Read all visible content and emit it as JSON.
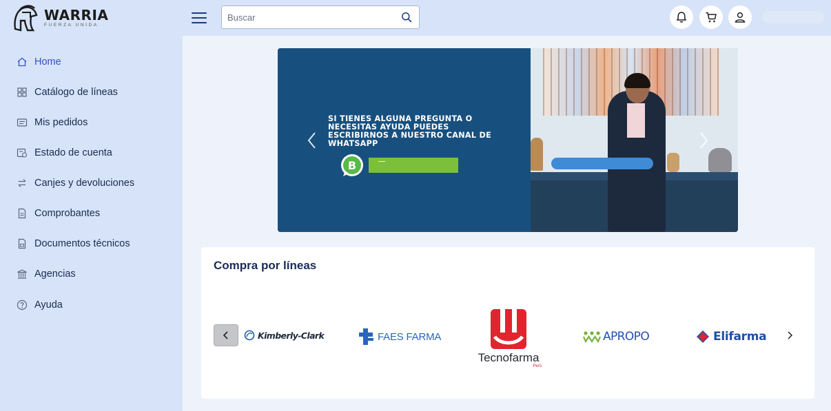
{
  "brand": {
    "name": "WARRIA",
    "tagline": "FUERZA UNIDA",
    "icon": "helmet-logo"
  },
  "header": {
    "menu_icon": "hamburger-menu-icon",
    "search": {
      "placeholder": "Buscar",
      "value": "",
      "icon": "search-icon"
    },
    "actions": [
      {
        "name": "notifications",
        "icon": "bell-icon"
      },
      {
        "name": "cart",
        "icon": "cart-icon"
      },
      {
        "name": "profile",
        "icon": "user-icon"
      }
    ]
  },
  "sidebar": {
    "items": [
      {
        "label": "Home",
        "icon": "home-icon",
        "active": true
      },
      {
        "label": "Catálogo de líneas",
        "icon": "grid-icon",
        "active": false
      },
      {
        "label": "Mis pedidos",
        "icon": "list-icon",
        "active": false
      },
      {
        "label": "Estado de cuenta",
        "icon": "account-statement-icon",
        "active": false
      },
      {
        "label": "Canjes y devoluciones",
        "icon": "exchange-icon",
        "active": false
      },
      {
        "label": "Comprobantes",
        "icon": "receipt-icon",
        "active": false
      },
      {
        "label": "Documentos técnicos",
        "icon": "document-icon",
        "active": false
      },
      {
        "label": "Agencias",
        "icon": "bank-icon",
        "active": false
      },
      {
        "label": "Ayuda",
        "icon": "help-icon",
        "active": false
      }
    ]
  },
  "banner": {
    "text": "SI TIENES ALGUNA PREGUNTA O NECESITAS AYUDA PUEDES ESCRIBIRNOS A NUESTRO CANAL DE WHATSAPP",
    "whatsapp_icon": "whatsapp-business-icon",
    "prev_icon": "chevron-left-icon",
    "next_icon": "chevron-right-icon"
  },
  "lines_section": {
    "title": "Compra por líneas",
    "prev_icon": "chevron-left-icon",
    "next_icon": "chevron-right-icon",
    "brands": [
      {
        "name": "Kimberly-Clark"
      },
      {
        "name": "FAES FARMA"
      },
      {
        "name": "Tecnofarma",
        "sub": "Perú"
      },
      {
        "name": "APROPO"
      },
      {
        "name": "Elifarma"
      }
    ]
  },
  "colors": {
    "sidebar_bg": "#d6e3f8",
    "page_bg": "#eef3fb",
    "active_nav": "#3550c8",
    "banner_bg": "#17507f",
    "whatsapp_green": "#7cbf3b"
  }
}
